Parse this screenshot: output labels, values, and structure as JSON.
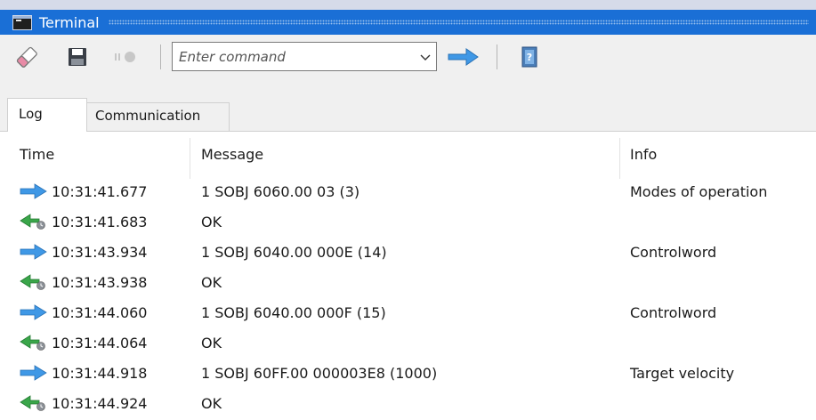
{
  "window": {
    "title": "Terminal"
  },
  "toolbar": {
    "icons": [
      "eraser-icon",
      "save-icon",
      "record-icon",
      "send-arrow-icon",
      "help-book-icon"
    ],
    "command": {
      "placeholder": "Enter command",
      "value": ""
    }
  },
  "tabs": [
    {
      "label": "Log",
      "active": true
    },
    {
      "label": "Communication",
      "active": false
    }
  ],
  "table": {
    "columns": [
      "Time",
      "Message",
      "Info"
    ],
    "rows": [
      {
        "direction": "sent",
        "time": "10:31:41.677",
        "message": "1 SOBJ 6060.00 03 (3)",
        "info": "Modes of operation"
      },
      {
        "direction": "received",
        "time": "10:31:41.683",
        "message": "OK",
        "info": ""
      },
      {
        "direction": "sent",
        "time": "10:31:43.934",
        "message": "1 SOBJ 6040.00 000E (14)",
        "info": "Controlword"
      },
      {
        "direction": "received",
        "time": "10:31:43.938",
        "message": "OK",
        "info": ""
      },
      {
        "direction": "sent",
        "time": "10:31:44.060",
        "message": "1 SOBJ 6040.00 000F (15)",
        "info": "Controlword"
      },
      {
        "direction": "received",
        "time": "10:31:44.064",
        "message": "OK",
        "info": ""
      },
      {
        "direction": "sent",
        "time": "10:31:44.918",
        "message": "1 SOBJ 60FF.00 000003E8 (1000)",
        "info": "Target velocity"
      },
      {
        "direction": "received",
        "time": "10:31:44.924",
        "message": "OK",
        "info": ""
      }
    ]
  },
  "colors": {
    "titlebar": "#1a6fd6",
    "sent_arrow": "#3f98e6",
    "received_arrow": "#3aa64a"
  }
}
